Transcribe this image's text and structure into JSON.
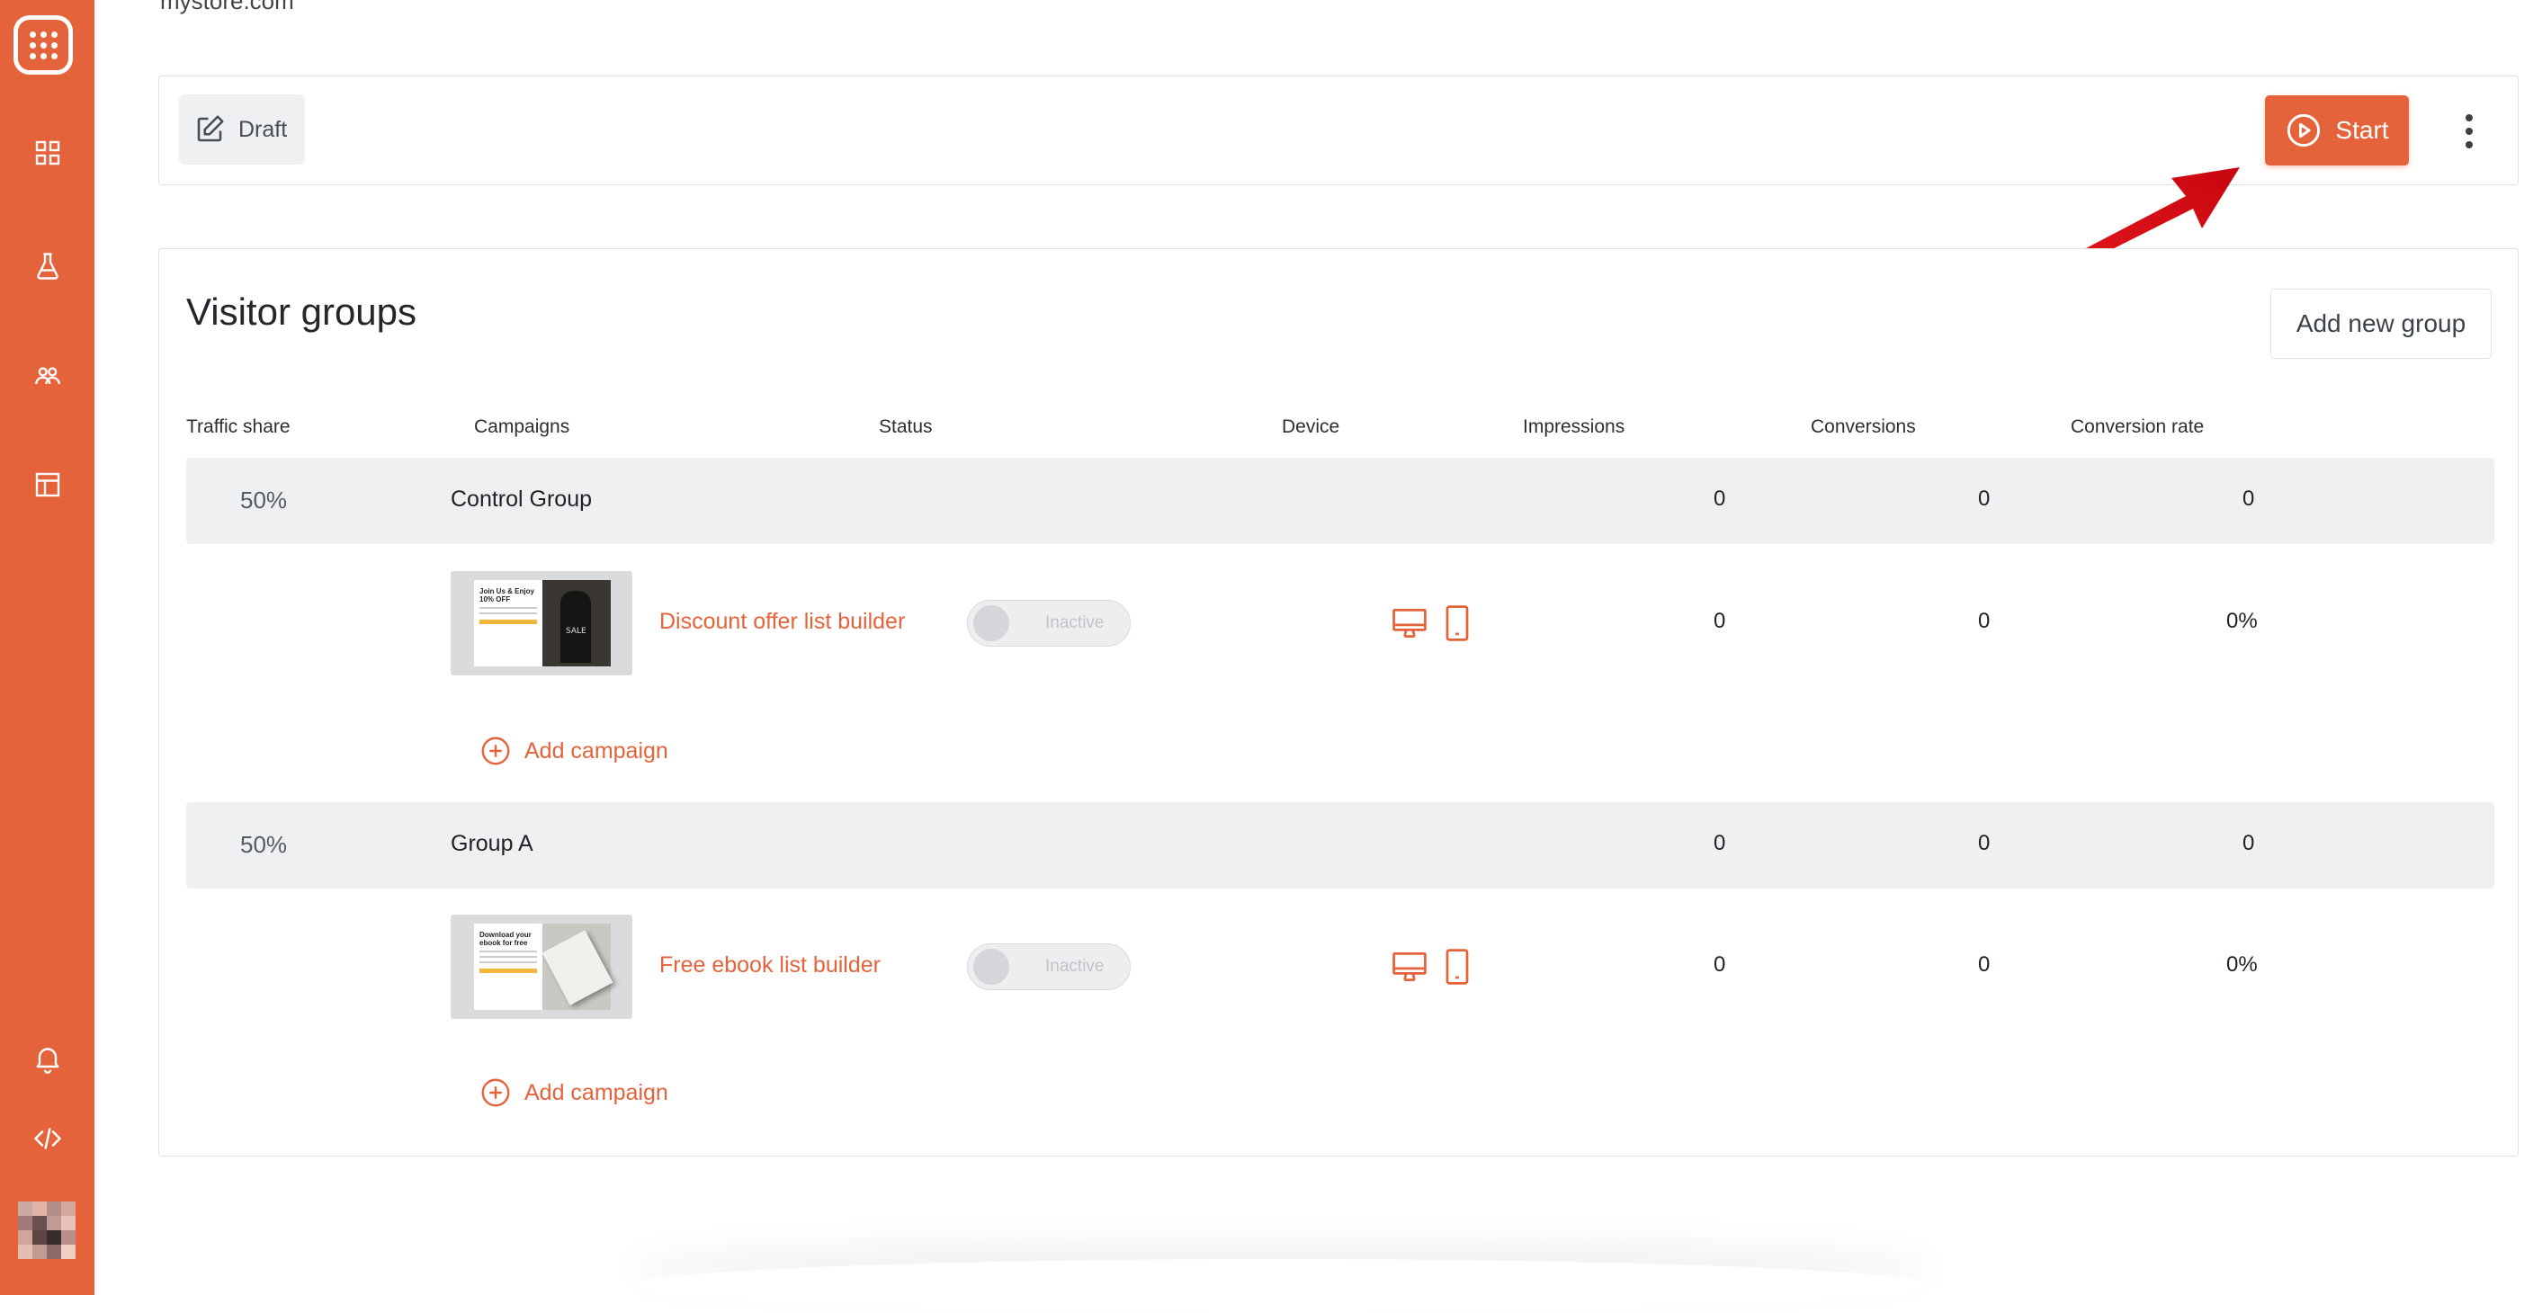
{
  "site": {
    "url": "mystore.com"
  },
  "sidebar": {
    "items": [
      {
        "icon": "dashboard-grid-icon"
      },
      {
        "icon": "flask-icon"
      },
      {
        "icon": "users-icon"
      },
      {
        "icon": "layout-icon"
      },
      {
        "icon": "bell-icon"
      },
      {
        "icon": "code-icon"
      }
    ]
  },
  "toolbar": {
    "draft_label": "Draft",
    "start_label": "Start"
  },
  "visitor_groups": {
    "title": "Visitor groups",
    "add_group_label": "Add new group",
    "columns": [
      "Traffic share",
      "Campaigns",
      "Status",
      "Device",
      "Impressions",
      "Conversions",
      "Conversion rate"
    ],
    "groups": [
      {
        "share": "50%",
        "name": "Control Group",
        "impressions": "0",
        "conversions": "0",
        "rate": "0",
        "campaign": {
          "name": "Discount offer list builder",
          "status": "Inactive",
          "impressions": "0",
          "conversions": "0",
          "rate": "0%",
          "thumb_text": "Join Us & Enjoy 10% OFF",
          "thumb_image_text": "SALE"
        },
        "add_campaign_label": "Add campaign"
      },
      {
        "share": "50%",
        "name": "Group A",
        "impressions": "0",
        "conversions": "0",
        "rate": "0",
        "campaign": {
          "name": "Free ebook list builder",
          "status": "Inactive",
          "impressions": "0",
          "conversions": "0",
          "rate": "0%",
          "thumb_text": "Download your ebook for free"
        },
        "add_campaign_label": "Add campaign"
      }
    ]
  },
  "colors": {
    "brand": "#e5633b",
    "annotation_arrow": "#e0141c"
  }
}
